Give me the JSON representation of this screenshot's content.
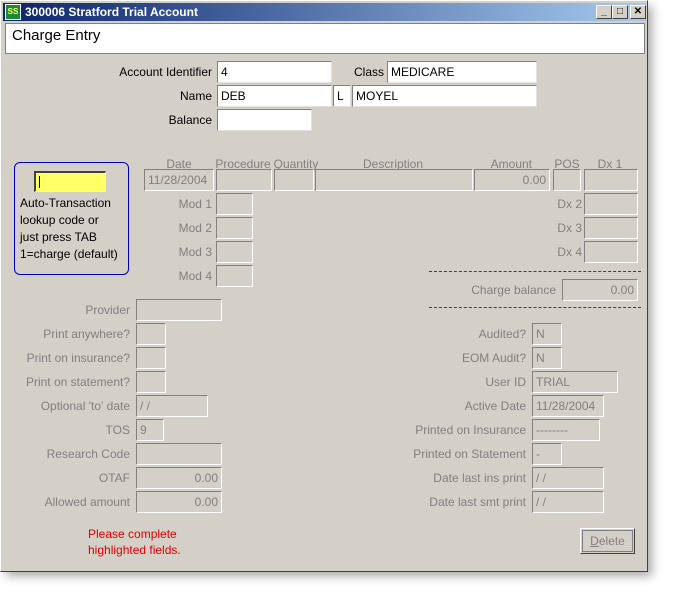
{
  "window": {
    "title": "300006 Stratford Trial Account",
    "icon_text": "SS",
    "controls": {
      "minimize": "_",
      "maximize": "□",
      "close": "✕"
    }
  },
  "header": {
    "title": "Charge Entry"
  },
  "account": {
    "identifier_label": "Account Identifier",
    "identifier_value": "4",
    "class_label": "Class",
    "class_value": "MEDICARE",
    "name_label": "Name",
    "first_name": "DEB",
    "middle_initial": "L",
    "last_name": "MOYEL",
    "balance_label": "Balance",
    "balance_value": ""
  },
  "help": {
    "auto_value": "",
    "lines": [
      "Auto-Transaction",
      "lookup code or",
      "just press TAB",
      "1=charge (default)"
    ]
  },
  "charge_line": {
    "date_label": "Date",
    "date_value": "11/28/2004",
    "procedure_label": "Procedure",
    "procedure_value": "",
    "quantity_label": "Quantity",
    "quantity_value": "",
    "description_label": "Description",
    "description_value": "",
    "amount_label": "Amount",
    "amount_value": "0.00",
    "pos_label": "POS",
    "pos_value": "",
    "dx1_label": "Dx 1",
    "dx1_value": ""
  },
  "modifiers": [
    {
      "label": "Mod 1",
      "value": ""
    },
    {
      "label": "Mod 2",
      "value": ""
    },
    {
      "label": "Mod 3",
      "value": ""
    },
    {
      "label": "Mod 4",
      "value": ""
    }
  ],
  "diagnoses": [
    {
      "label": "Dx 2",
      "value": ""
    },
    {
      "label": "Dx 3",
      "value": ""
    },
    {
      "label": "Dx 4",
      "value": ""
    }
  ],
  "charge_balance": {
    "label": "Charge balance",
    "value": "0.00"
  },
  "left_fields": {
    "provider": {
      "label": "Provider",
      "value": ""
    },
    "print_anywhere": {
      "label": "Print anywhere?",
      "value": ""
    },
    "print_on_insurance": {
      "label": "Print on insurance?",
      "value": ""
    },
    "print_on_statement": {
      "label": "Print on statement?",
      "value": ""
    },
    "optional_to_date": {
      "label": "Optional 'to' date",
      "value": " /  /"
    },
    "tos": {
      "label": "TOS",
      "value": "9"
    },
    "research_code": {
      "label": "Research Code",
      "value": ""
    },
    "otaf": {
      "label": "OTAF",
      "value": "0.00"
    },
    "allowed_amount": {
      "label": "Allowed amount",
      "value": "0.00"
    }
  },
  "right_fields": {
    "audited": {
      "label": "Audited?",
      "value": "N"
    },
    "eom_audit": {
      "label": "EOM Audit?",
      "value": "N"
    },
    "user_id": {
      "label": "User ID",
      "value": "TRIAL"
    },
    "active_date": {
      "label": "Active Date",
      "value": "11/28/2004"
    },
    "printed_on_insurance": {
      "label": "Printed on Insurance",
      "value": "--------"
    },
    "printed_on_statement": {
      "label": "Printed on Statement",
      "value": "-"
    },
    "date_last_ins_print": {
      "label": "Date last ins print",
      "value": " /  /"
    },
    "date_last_smt_print": {
      "label": "Date last smt print",
      "value": " /  /"
    }
  },
  "warning": {
    "line1": "Please complete",
    "line2": "highlighted fields."
  },
  "buttons": {
    "delete_first": "D",
    "delete_rest": "elete"
  },
  "colors": {
    "highlight": "#ffff66",
    "warning": "#e00000",
    "titlebar": "#0a246a"
  }
}
